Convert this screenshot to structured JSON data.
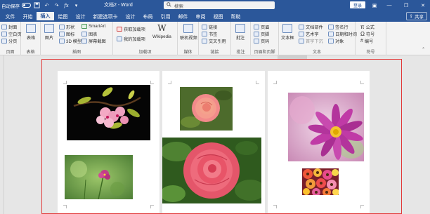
{
  "titlebar": {
    "autosave_label": "自动保存",
    "toggle_state": "关",
    "doc_title": "文档2 - Word",
    "search_placeholder": "搜索",
    "signin_label": "登录",
    "icons": [
      "save-icon",
      "undo-icon",
      "redo-icon",
      "formula-icon",
      "dropdown-icon"
    ]
  },
  "tabs": {
    "items": [
      "文件",
      "开始",
      "插入",
      "绘图",
      "设计",
      "新建选项卡",
      "设计",
      "布局",
      "引用",
      "邮件",
      "审阅",
      "视图",
      "帮助"
    ],
    "active": "插入",
    "share_label": "共享"
  },
  "ribbon": {
    "pages": {
      "label": "页面",
      "items": [
        "封面",
        "空白页",
        "分页"
      ]
    },
    "tables": {
      "label": "表格",
      "item": "表格"
    },
    "illustrations": {
      "label": "插图",
      "pictures": "图片",
      "shapes": "形状",
      "icons": "图标",
      "models": "3D 模型",
      "smartart": "SmartArt",
      "chart": "图表",
      "screenshot": "屏幕截图"
    },
    "addins": {
      "label": "加载项",
      "get": "获取加载项",
      "mine": "我的加载项",
      "wikipedia": "Wikipedia"
    },
    "media": {
      "label": "媒体",
      "video": "联机视频"
    },
    "links": {
      "label": "链接",
      "link": "链接",
      "bookmark": "书签",
      "crossref": "交叉引用"
    },
    "comments": {
      "label": "批注",
      "comment": "批注"
    },
    "headerfooter": {
      "label": "页眉和页脚",
      "header": "页眉",
      "footer": "页脚",
      "pagenum": "页码"
    },
    "text": {
      "label": "文本",
      "textbox": "文本框",
      "parts": "文档部件",
      "wordart": "艺术字",
      "dropcap": "首字下沉",
      "signature": "签名行",
      "datetime": "日期和时间",
      "object": "对象"
    },
    "symbols": {
      "label": "符号",
      "equation": "公式",
      "symbol": "符号",
      "number": "编号"
    }
  },
  "colors": {
    "brand": "#2b579a",
    "highlight": "#e23a3a"
  }
}
